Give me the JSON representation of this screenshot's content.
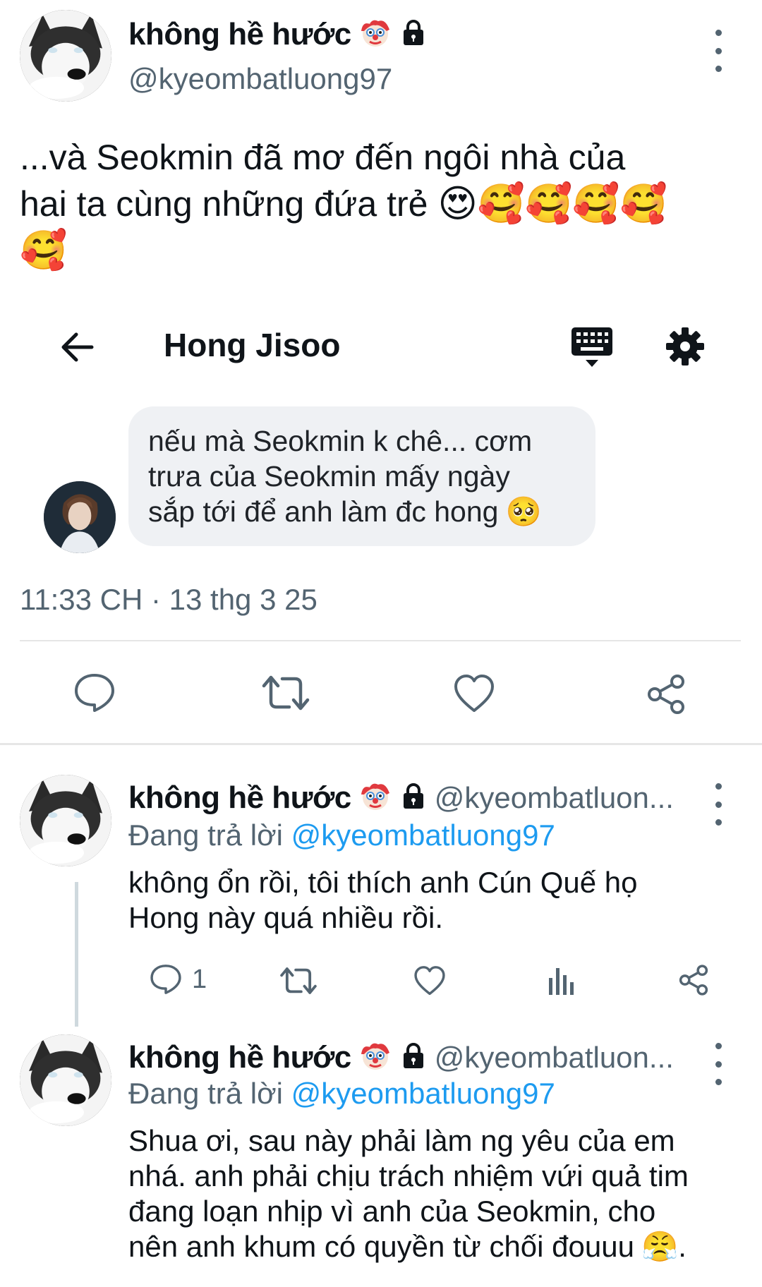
{
  "main_tweet": {
    "display_name": "không hề hước",
    "handle": "@kyeombatluong97",
    "text_line1": "...và Seokmin đã mơ đến ngôi nhà của",
    "text_line2": "hai ta cùng những đứa trẻ",
    "emojis": [
      "😍",
      "🥰",
      "🥰",
      "🥰",
      "🥰",
      "🥰"
    ],
    "embedded_chat": {
      "title": "Hong Jisoo",
      "message_lines": [
        "nếu mà Seokmin k chê... cơm",
        "trưa của Seokmin mấy ngày",
        "sắp tới để anh làm đc hong"
      ],
      "message_emoji": "🥺"
    },
    "timestamp": "11:33 CH · 13 thg 3 25"
  },
  "replies": [
    {
      "display_name": "không hề hước",
      "handle": "@kyeombatluon...",
      "replying_prefix": "Đang trả lời",
      "replying_to": "@kyeombatluong97",
      "text_lines": [
        "không ổn rồi, tôi thích anh Cún Quế họ",
        "Hong này quá nhiều rồi."
      ],
      "reply_count": "1"
    },
    {
      "display_name": "không hề hước",
      "handle": "@kyeombatluon...",
      "replying_prefix": "Đang trả lời",
      "replying_to": "@kyeombatluong97",
      "text_lines": [
        "Shua ơi, sau này phải làm ng yêu của em",
        "nhá. anh phải chịu trách nhiệm vứi quả tim",
        "đang loạn nhịp vì anh của Seokmin, cho",
        "nên anh khum có quyền từ chối đouuu"
      ],
      "end_emoji": "😤",
      "end_punct": "."
    }
  ],
  "colors": {
    "accent": "#1d9bf0",
    "secondary_text": "#536471",
    "bubble": "#eff1f4"
  },
  "icons": [
    "clown-emoji",
    "lock-icon",
    "more-icon",
    "back-arrow-icon",
    "keyboard-icon",
    "settings-icon",
    "reply-icon",
    "retweet-icon",
    "like-icon",
    "share-icon",
    "analytics-icon"
  ]
}
